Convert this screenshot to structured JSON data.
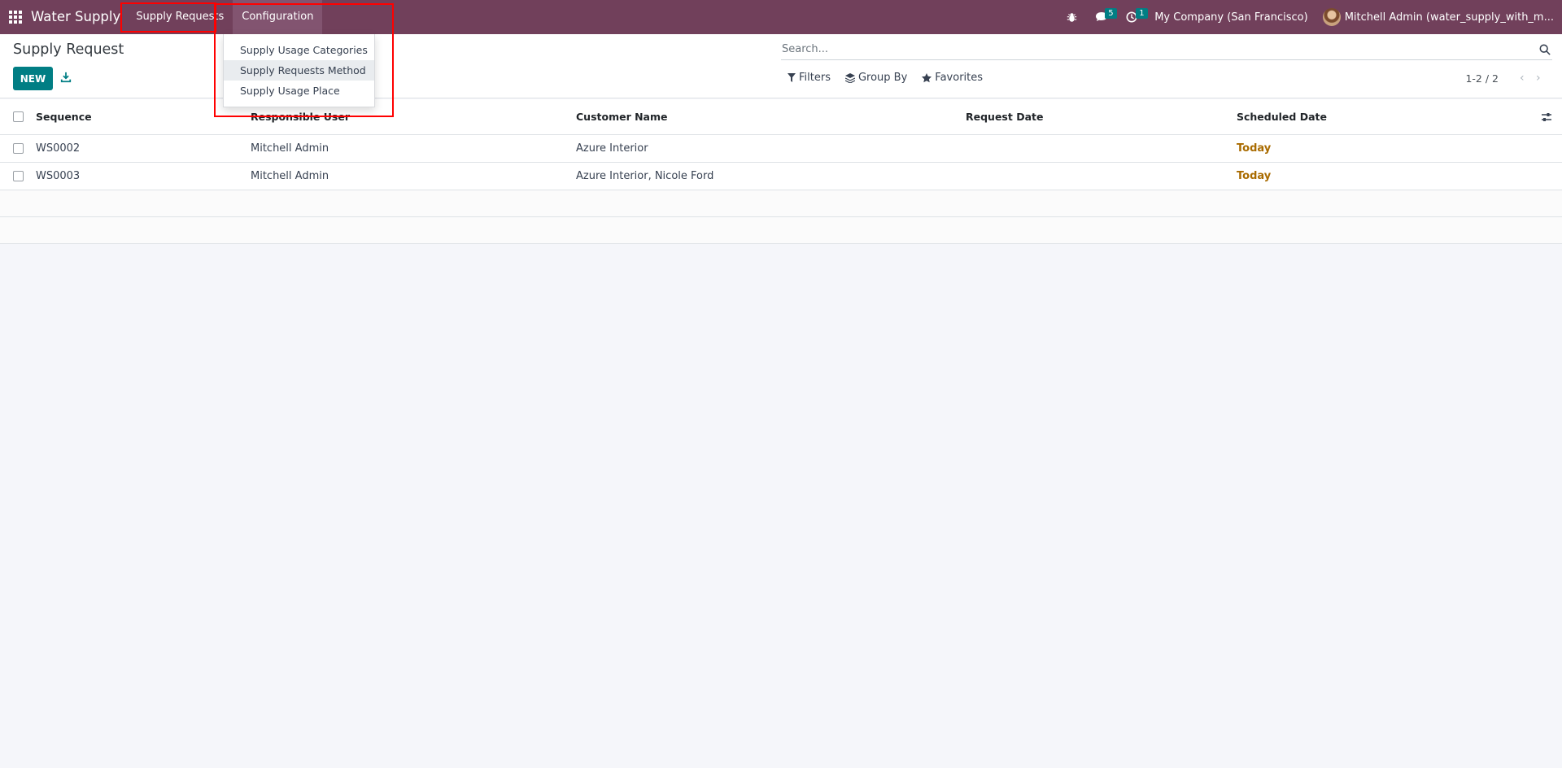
{
  "navbar": {
    "brand": "Water Supply",
    "menus": [
      "Supply Requests",
      "Configuration"
    ],
    "messages_count": "5",
    "activities_count": "1",
    "company": "My Company (San Francisco)",
    "user": "Mitchell Admin (water_supply_with_m..."
  },
  "dropdown": {
    "items": [
      "Supply Usage Categories",
      "Supply Requests Method",
      "Supply Usage Place"
    ]
  },
  "control_panel": {
    "title": "Supply Request",
    "new_label": "NEW",
    "search_placeholder": "Search...",
    "filters_label": "Filters",
    "group_by_label": "Group By",
    "favorites_label": "Favorites",
    "pager_value": "1-2 / 2"
  },
  "table": {
    "columns": [
      "Sequence",
      "Responsible User",
      "Customer Name",
      "Request Date",
      "Scheduled Date"
    ],
    "rows": [
      {
        "sequence": "WS0002",
        "responsible_user": "Mitchell Admin",
        "customer_name": "Azure Interior",
        "request_date": "",
        "scheduled_date": "Today"
      },
      {
        "sequence": "WS0003",
        "responsible_user": "Mitchell Admin",
        "customer_name": "Azure Interior, Nicole Ford",
        "request_date": "",
        "scheduled_date": "Today"
      }
    ]
  },
  "colors": {
    "navbar": "#71405b",
    "primary_button": "#017e84",
    "today_text": "#a96b00",
    "highlight": "#ff0000"
  }
}
